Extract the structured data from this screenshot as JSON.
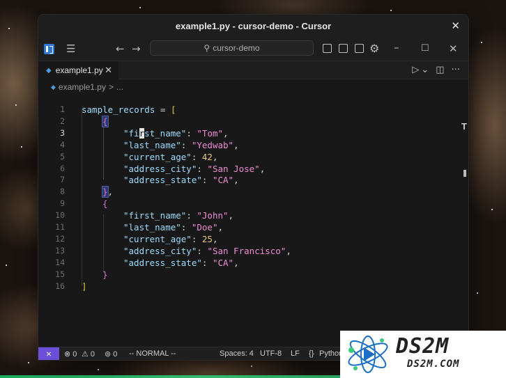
{
  "window": {
    "title": "example1.py - cursor-demo - Cursor",
    "close_glyph": "✕"
  },
  "toolbar": {
    "menu_glyph": "☰",
    "back_glyph": "←",
    "forward_glyph": "→",
    "search_glyph": "⚲",
    "search_text": "cursor-demo",
    "settings_glyph": "⚙",
    "minimize_glyph": "–",
    "maximize_glyph": "☐",
    "close_glyph": "✕"
  },
  "tab": {
    "label": "example1.py",
    "close_glyph": "✕",
    "run_glyph": "▷",
    "dropdown_glyph": "⌄",
    "split_glyph": "◫",
    "more_glyph": "···"
  },
  "breadcrumb": {
    "file": "example1.py",
    "sep": ">",
    "rest": "..."
  },
  "editor": {
    "active_line": 3,
    "lines": [
      {
        "n": "1",
        "t": "sample_records = ["
      },
      {
        "n": "2",
        "t": "{"
      },
      {
        "n": "3",
        "t": "\"first_name\": \"Tom\","
      },
      {
        "n": "4",
        "t": "\"last_name\": \"Yedwab\","
      },
      {
        "n": "5",
        "t": "\"current_age\": 42,"
      },
      {
        "n": "6",
        "t": "\"address_city\": \"San Jose\","
      },
      {
        "n": "7",
        "t": "\"address_state\": \"CA\","
      },
      {
        "n": "8",
        "t": "},"
      },
      {
        "n": "9",
        "t": "{"
      },
      {
        "n": "10",
        "t": "\"first_name\": \"John\","
      },
      {
        "n": "11",
        "t": "\"last_name\": \"Doe\","
      },
      {
        "n": "12",
        "t": "\"current_age\": 25,"
      },
      {
        "n": "13",
        "t": "\"address_city\": \"San Francisco\","
      },
      {
        "n": "14",
        "t": "\"address_state\": \"CA\","
      },
      {
        "n": "15",
        "t": "}"
      },
      {
        "n": "16",
        "t": "]"
      }
    ]
  },
  "statusbar": {
    "remote_glyph": "⨯",
    "errors": "⊗ 0",
    "warnings": "⚠ 0",
    "ports": "⊚ 0",
    "mode": "-- NORMAL --",
    "spaces": "Spaces: 4",
    "encoding": "UTF-8",
    "eol": "LF",
    "language": "Python"
  },
  "logo": {
    "title": "DS2M",
    "subtitle": "DS2M.COM"
  },
  "colors": {
    "key": "#9cdcfe",
    "string": "#f08bd6",
    "number": "#e8c675",
    "bracket_outer": "#e2c541",
    "bracket_inner": "#d670d6",
    "remote_bg": "#6b4fd8"
  }
}
